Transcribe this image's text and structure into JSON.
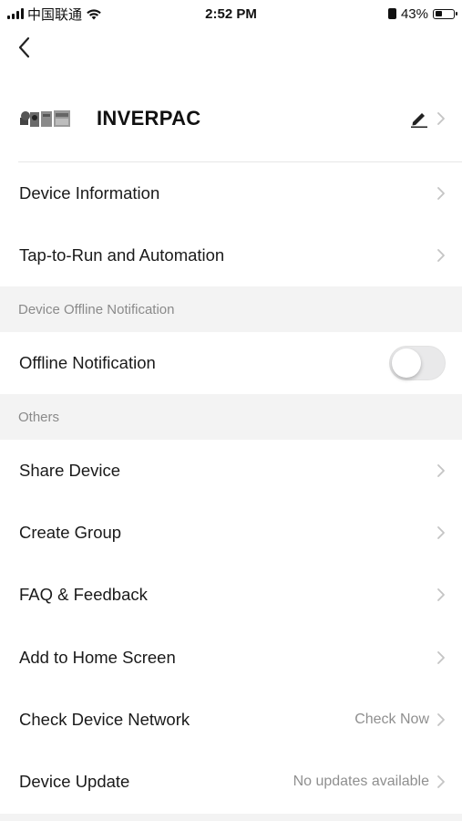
{
  "status_bar": {
    "carrier": "中国联通",
    "time": "2:52 PM",
    "battery_percent": "43%",
    "battery_level": 0.43,
    "icons": [
      "signal-icon",
      "wifi-icon",
      "orientation-lock-icon",
      "battery-icon"
    ]
  },
  "nav": {
    "back_icon": "chevron-left-icon"
  },
  "device": {
    "name": "INVERPAC",
    "edit_icon": "pencil-icon"
  },
  "rows_top": [
    {
      "label": "Device Information"
    },
    {
      "label": "Tap-to-Run and Automation"
    }
  ],
  "section_offline": {
    "header": "Device Offline Notification",
    "toggle_label": "Offline Notification",
    "toggle_on": false
  },
  "section_others": {
    "header": "Others",
    "items": [
      {
        "label": "Share Device",
        "value": ""
      },
      {
        "label": "Create Group",
        "value": ""
      },
      {
        "label": "FAQ & Feedback",
        "value": ""
      },
      {
        "label": "Add to Home Screen",
        "value": ""
      },
      {
        "label": "Check Device Network",
        "value": "Check Now"
      },
      {
        "label": "Device Update",
        "value": "No updates available"
      }
    ]
  },
  "colors": {
    "background": "#ffffff",
    "section_bg": "#f3f3f3",
    "secondary_text": "#8f8f8f",
    "chevron": "#c4c4c4"
  }
}
